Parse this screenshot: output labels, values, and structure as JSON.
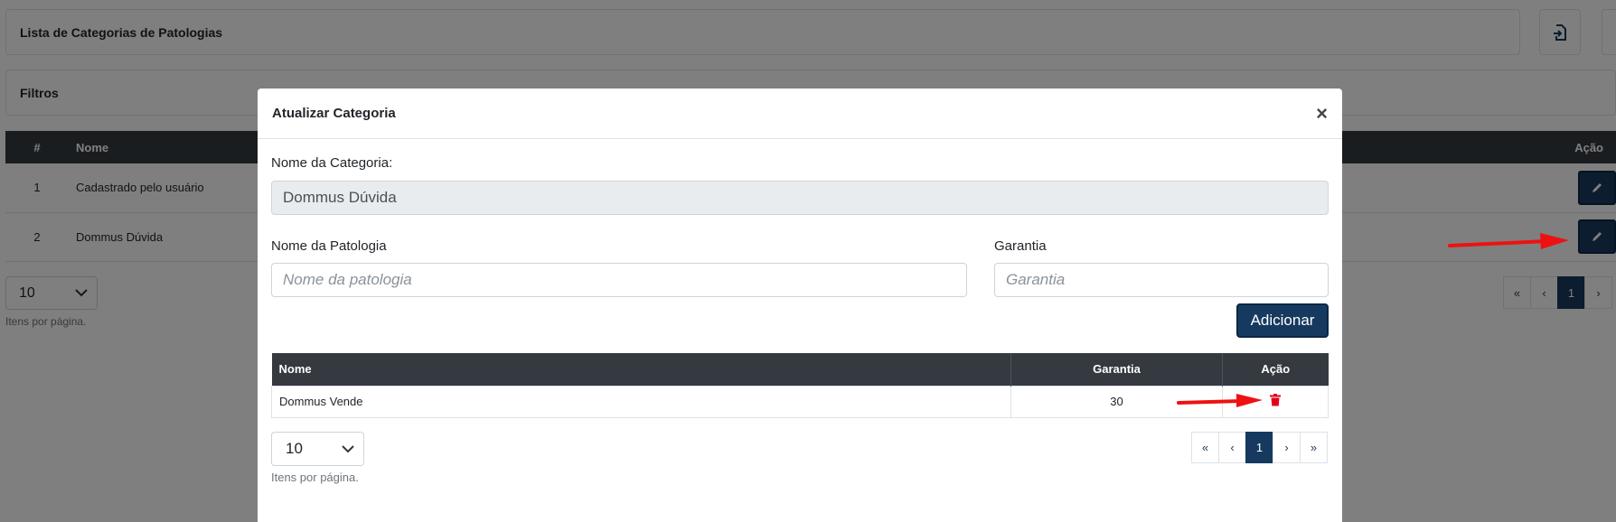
{
  "background": {
    "header_title": "Lista de Categorias de Patologias",
    "filters_title": "Filtros",
    "table": {
      "headers": [
        "#",
        "Nome",
        "Ação"
      ],
      "rows": [
        {
          "id": "1",
          "name": "Cadastrado pelo usuário"
        },
        {
          "id": "2",
          "name": "Dommus Dúvida"
        }
      ]
    },
    "per_page_value": "10",
    "per_page_caption": "Itens por página.",
    "pager": [
      "«",
      "‹",
      "1",
      "›"
    ]
  },
  "modal": {
    "title": "Atualizar Categoria",
    "close": "×",
    "category_label": "Nome da Categoria:",
    "category_value": "Dommus Dúvida",
    "pathology_label": "Nome da Patologia",
    "pathology_placeholder": "Nome da patologia",
    "warranty_label": "Garantia",
    "warranty_placeholder": "Garantia",
    "add_button": "Adicionar",
    "table": {
      "headers": [
        "Nome",
        "Garantia",
        "Ação"
      ],
      "rows": [
        {
          "name": "Dommus Vende",
          "warranty": "30"
        }
      ]
    },
    "per_page_value": "10",
    "per_page_caption": "Itens por página.",
    "pager": [
      "«",
      "‹",
      "1",
      "›",
      "»"
    ]
  },
  "colors": {
    "primary": "#163a5f",
    "table_header": "#343a40",
    "danger": "#e3001b",
    "annotation_arrow": "#ee1111"
  },
  "icons": {
    "import": "file-import-icon",
    "edit": "pencil-icon",
    "delete": "trash-icon"
  }
}
